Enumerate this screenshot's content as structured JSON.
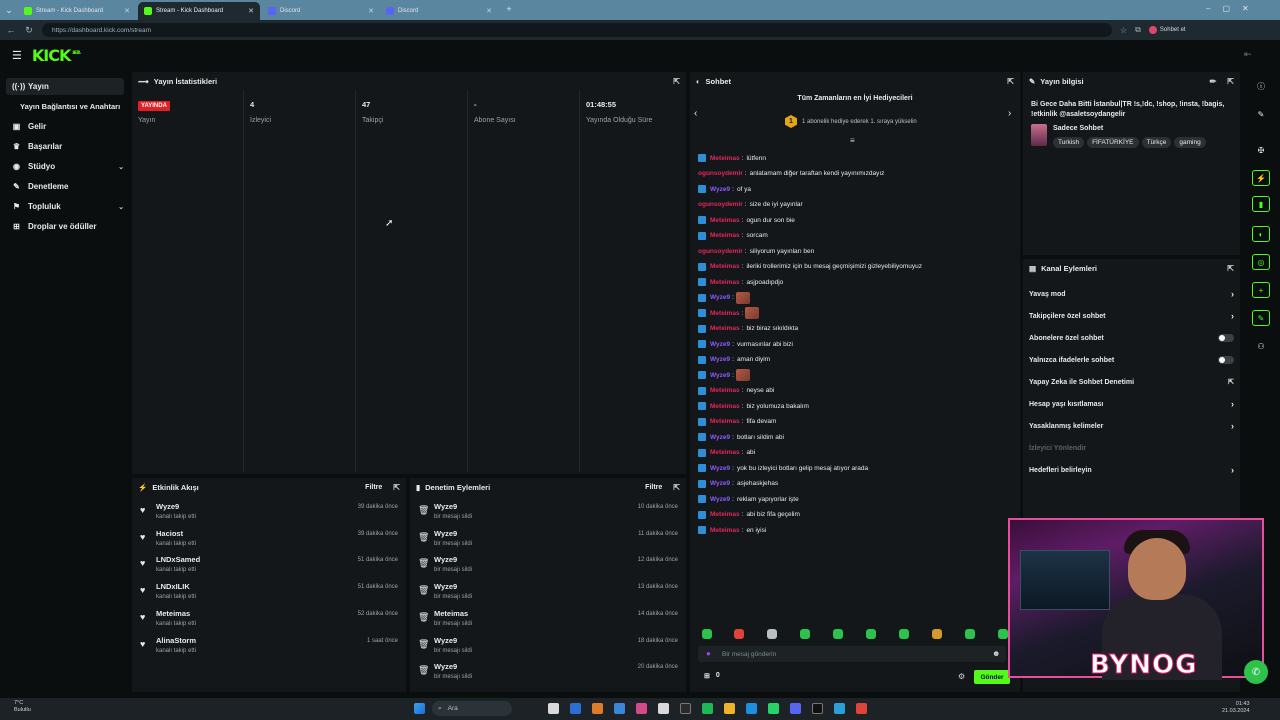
{
  "browser": {
    "tabs": [
      {
        "title": "Stream - Kick Dashboard",
        "active": false
      },
      {
        "title": "Stream - Kick Dashboard",
        "active": true
      },
      {
        "title": "Discord",
        "active": false
      },
      {
        "title": "Discord",
        "active": false
      }
    ],
    "url": "https://dashboard.kick.com/stream",
    "profile_label": "Sohbet et"
  },
  "app": {
    "logo": "KICK",
    "logo_sup": "BETA"
  },
  "sidebar": {
    "items": [
      {
        "label": "Yayın",
        "icon": "broadcast-icon",
        "active": true
      },
      {
        "label": "Yayın Bağlantısı ve Anahtarı",
        "icon": "",
        "active": false
      },
      {
        "label": "Gelir",
        "icon": "wallet-icon",
        "active": false
      },
      {
        "label": "Başarılar",
        "icon": "trophy-icon",
        "active": false
      },
      {
        "label": "Stüdyo",
        "icon": "studio-icon",
        "active": false,
        "expand": true
      },
      {
        "label": "Denetleme",
        "icon": "wrench-icon",
        "active": false
      },
      {
        "label": "Topluluk",
        "icon": "community-icon",
        "active": false,
        "expand": true
      },
      {
        "label": "Droplar ve ödüller",
        "icon": "gift-icon",
        "active": false
      }
    ]
  },
  "stats": {
    "title": "Yayın İstatistikleri",
    "live_badge": "YAYINDA",
    "cols": [
      {
        "value": "",
        "label": "Yayın"
      },
      {
        "value": "4",
        "label": "İzleyici"
      },
      {
        "value": "47",
        "label": "Takipçi"
      },
      {
        "value": "-",
        "label": "Abone Sayısı"
      },
      {
        "value": "01:48:55",
        "label": "Yayında Olduğu Süre"
      }
    ]
  },
  "activity": {
    "title": "Etkinlik Akışı",
    "filter": "Filtre",
    "rows": [
      {
        "name": "Wyze9",
        "sub": "kanalı takip etti",
        "time": "39 dakika önce"
      },
      {
        "name": "Haciost",
        "sub": "kanalı takip etti",
        "time": "39 dakika önce"
      },
      {
        "name": "LNDxSamed",
        "sub": "kanalı takip etti",
        "time": "51 dakika önce"
      },
      {
        "name": "LNDxILIK",
        "sub": "kanalı takip etti",
        "time": "51 dakika önce"
      },
      {
        "name": "Meteimas",
        "sub": "kanalı takip etti",
        "time": "52 dakika önce"
      },
      {
        "name": "AlinaStorm",
        "sub": "kanalı takip etti",
        "time": "1 saat önce"
      }
    ]
  },
  "moderation": {
    "title": "Denetim Eylemleri",
    "filter": "Filtre",
    "rows": [
      {
        "name": "Wyze9",
        "sub": "bir mesajı sildi",
        "time": "10 dakika önce"
      },
      {
        "name": "Wyze9",
        "sub": "bir mesajı sildi",
        "time": "11 dakika önce"
      },
      {
        "name": "Wyze9",
        "sub": "bir mesajı sildi",
        "time": "12 dakika önce"
      },
      {
        "name": "Wyze9",
        "sub": "bir mesajı sildi",
        "time": "13 dakika önce"
      },
      {
        "name": "Meteimas",
        "sub": "bir mesajı sildi",
        "time": "14 dakika önce"
      },
      {
        "name": "Wyze9",
        "sub": "bir mesajı sildi",
        "time": "18 dakika önce"
      },
      {
        "name": "Wyze9",
        "sub": "bir mesajı sildi",
        "time": "20 dakika önce"
      }
    ]
  },
  "chat": {
    "title": "Sohbet",
    "gifters_title": "Tüm Zamanların en İyi Hediyecileri",
    "gift_rank": "1",
    "gift_text": "1 abonelik hediye ederek 1. sıraya yükselin",
    "input_placeholder": "Bir mesaj gönderin",
    "send": "Gönder",
    "count": "0",
    "messages": [
      {
        "user": "Meteimas",
        "color": "red",
        "badge": true,
        "text": "lütfenn"
      },
      {
        "user": "ogunsoydemir",
        "color": "pink",
        "badge": false,
        "text": "anlatamam diğer taraftan kendi yayınımızdayız"
      },
      {
        "user": "Wyze9",
        "color": "purple",
        "badge": true,
        "text": "of ya"
      },
      {
        "user": "ogunsoydemir",
        "color": "pink",
        "badge": false,
        "text": "size de iyi yayınlar"
      },
      {
        "user": "Meteimas",
        "color": "red",
        "badge": true,
        "text": "ogun dur son bie"
      },
      {
        "user": "Meteimas",
        "color": "red",
        "badge": true,
        "text": "sorcam"
      },
      {
        "user": "ogunsoydemir",
        "color": "pink",
        "badge": false,
        "text": "siliyorum yayınları ben"
      },
      {
        "user": "Meteimas",
        "color": "red",
        "badge": true,
        "text": "ileriki trollerimiz için bu mesaj geçmişimizi gizleyebiliyomuyuz"
      },
      {
        "user": "Meteimas",
        "color": "red",
        "badge": true,
        "text": "asjpoadıpdjo"
      },
      {
        "user": "Wyze9",
        "color": "purple",
        "badge": true,
        "text": "",
        "emote": true
      },
      {
        "user": "Meteimas",
        "color": "red",
        "badge": true,
        "text": "",
        "emote": true
      },
      {
        "user": "Meteimas",
        "color": "red",
        "badge": true,
        "text": "biz biraz sıkıldıkta"
      },
      {
        "user": "Wyze9",
        "color": "purple",
        "badge": true,
        "text": "vurmasınlar abi bizi"
      },
      {
        "user": "Wyze9",
        "color": "purple",
        "badge": true,
        "text": "aman diyim"
      },
      {
        "user": "Wyze9",
        "color": "purple",
        "badge": true,
        "text": "",
        "emote": true
      },
      {
        "user": "Meteimas",
        "color": "red",
        "badge": true,
        "text": "neyse abi"
      },
      {
        "user": "Meteimas",
        "color": "red",
        "badge": true,
        "text": "biz yolumuza bakalım"
      },
      {
        "user": "Meteimas",
        "color": "red",
        "badge": true,
        "text": "fifa devam"
      },
      {
        "user": "Wyze9",
        "color": "purple",
        "badge": true,
        "text": "botları sildim abi"
      },
      {
        "user": "Meteimas",
        "color": "red",
        "badge": true,
        "text": "abi"
      },
      {
        "user": "Wyze9",
        "color": "purple",
        "badge": true,
        "text": "yok bu izleyici botları gelip mesaj atıyor arada"
      },
      {
        "user": "Wyze9",
        "color": "purple",
        "badge": true,
        "text": "asjehaskjehas"
      },
      {
        "user": "Wyze9",
        "color": "purple",
        "badge": true,
        "text": "reklam yapıyorlar işte"
      },
      {
        "user": "Meteimas",
        "color": "red",
        "badge": true,
        "text": "abi biz fifa geçelim"
      },
      {
        "user": "Meteimas",
        "color": "red",
        "badge": true,
        "text": "en iyisi"
      }
    ]
  },
  "info": {
    "title": "Yayın bilgisi",
    "stream_title": "Bi Gece Daha Bitti İstanbul|TR !s,!dc, !shop, !insta, !bagis, !etkinlik @asaletsoydangelir",
    "category": "Sadece Sohbet",
    "tags": [
      "Turkish",
      "FİFATÜRKİYE",
      "Türkçe",
      "gaming"
    ]
  },
  "actions": {
    "title": "Kanal Eylemleri",
    "rows": [
      {
        "label": "Yavaş mod",
        "control": "chevron"
      },
      {
        "label": "Takipçilere özel sohbet",
        "control": "chevron"
      },
      {
        "label": "Abonelere özel sohbet",
        "control": "toggle"
      },
      {
        "label": "Yalnızca ifadelerle sohbet",
        "control": "toggle"
      },
      {
        "label": "Yapay Zeka ile Sohbet Denetimi",
        "control": "external"
      },
      {
        "label": "Hesap yaşı kısıtlaması",
        "control": "chevron"
      },
      {
        "label": "Yasaklanmış kelimeler",
        "control": "chevron"
      },
      {
        "label": "İzleyici Yönlendir",
        "control": "none",
        "disabled": true
      },
      {
        "label": "Hedefleri belirleyin",
        "control": "chevron"
      }
    ]
  },
  "webcam": {
    "overlay_logo": "BYNOG"
  },
  "taskbar": {
    "weather_temp": "7°C",
    "weather_desc": "Bulutlu",
    "search": "Ara",
    "time": "01:43",
    "date": "21.03.2024"
  },
  "colors": {
    "accent": "#53fc18",
    "live": "#e01f26",
    "panel": "#131719"
  }
}
